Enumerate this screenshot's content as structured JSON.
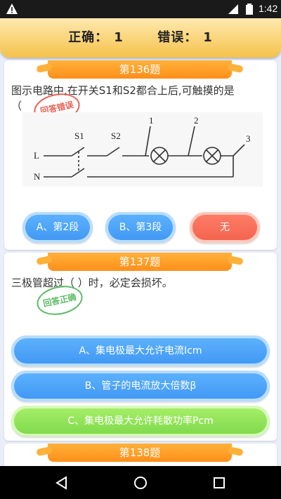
{
  "status_bar": {
    "time": "1:42",
    "icons": [
      "warning-icon",
      "signal-icon",
      "battery-icon"
    ]
  },
  "header": {
    "correct_label": "正确：",
    "correct_value": "1",
    "wrong_label": "错误：",
    "wrong_value": "1"
  },
  "questions": [
    {
      "title": "第136题",
      "text_line1": "图示电路中,在开关S1和S2都合上后,可触摸的是",
      "text_line2": "（",
      "stamp": "回答错误",
      "diagram_labels": {
        "s1": "S1",
        "s2": "S2",
        "n1": "1",
        "n2": "2",
        "n3": "3",
        "L": "L",
        "N": "N"
      },
      "options": [
        "A、第2段",
        "B、第3段",
        "无"
      ]
    },
    {
      "title": "第137题",
      "text_line1": "三极管超过（ ）时，必定会损坏。",
      "stamp": "回答正确",
      "options": [
        "A、集电极最大允许电流Icm",
        "B、管子的电流放大倍数β",
        "C、集电极最大允许耗散功率Pcm"
      ]
    },
    {
      "title": "第138题"
    }
  ],
  "colors": {
    "header_bg": "#f5c24a",
    "title_bg": "#ff8f1a",
    "option_blue": "#3f96f2",
    "option_red": "#f2624c",
    "option_green": "#7dd84a",
    "stamp_red": "#e0473a",
    "stamp_green": "#3fae4a"
  },
  "nav_icons": [
    "back-icon",
    "home-icon",
    "recents-icon"
  ]
}
